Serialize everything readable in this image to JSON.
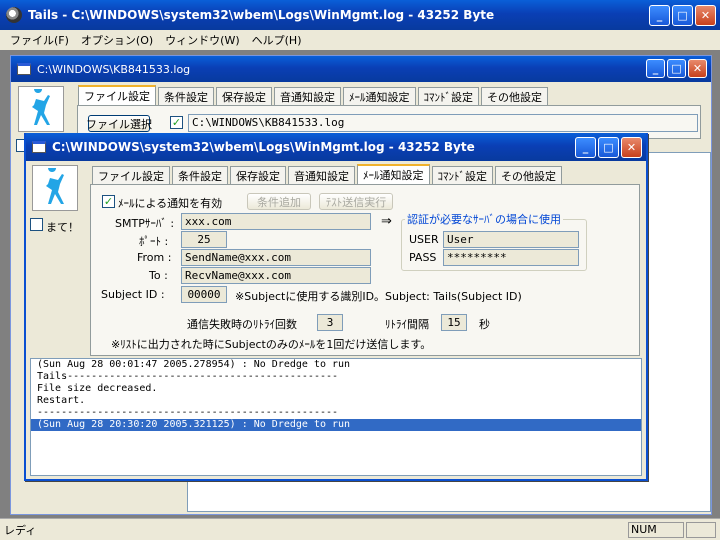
{
  "app": {
    "title": "Tails - C:\\WINDOWS\\system32\\wbem\\Logs\\WinMgmt.log - 43252 Byte",
    "menu": [
      "ファイル(F)",
      "オプション(O)",
      "ウィンドウ(W)",
      "ヘルプ(H)"
    ]
  },
  "window_buttons": {
    "minimize": "_",
    "maximize": "□",
    "close": "✕"
  },
  "status": {
    "main": "レディ",
    "num": "NUM"
  },
  "child1": {
    "title": "C:\\WINDOWS\\KB841533.log",
    "tabs": [
      "ファイル設定",
      "条件設定",
      "保存設定",
      "音通知設定",
      "ﾒｰﾙ通知設定",
      "ｺﾏﾝﾄﾞ設定",
      "その他設定"
    ],
    "file_select_label": "ファイル選択",
    "file_path": "C:\\WINDOWS\\KB841533.log"
  },
  "child2": {
    "title": "C:\\WINDOWS\\system32\\wbem\\Logs\\WinMgmt.log - 43252 Byte",
    "tabs": [
      "ファイル設定",
      "条件設定",
      "保存設定",
      "音通知設定",
      "ﾒｰﾙ通知設定",
      "ｺﾏﾝﾄﾞ設定",
      "その他設定"
    ],
    "active_tab": 4,
    "wait_label": "まて！",
    "mail_enable_label": "ﾒｰﾙによる通知を有効",
    "condition_add_label": "条件追加",
    "test_send_label": "ﾃｽﾄ送信実行",
    "smtp_label": "SMTPｻｰﾊﾞ :",
    "smtp_value": "xxx.com",
    "port_label": "ﾎﾟｰﾄ :",
    "port_value": "25",
    "from_label": "From :",
    "from_value": "SendName@xxx.com",
    "to_label": "To :",
    "to_value": "RecvName@xxx.com",
    "subject_label": "Subject ID :",
    "subject_value": "00000",
    "subject_note": "※Subjectに使用する識別ID。Subject: Tails(Subject ID)",
    "arrow": "⇒",
    "auth_title": "認証が必要なｻｰﾊﾞの場合に使用",
    "user_label": "USER",
    "user_value": "User",
    "pass_label": "PASS",
    "pass_value": "*********",
    "retry_count_label": "通信失敗時のﾘﾄﾗｲ回数",
    "retry_count_value": "3",
    "retry_interval_label": "ﾘﾄﾗｲ間隔",
    "retry_interval_value": "15",
    "retry_interval_unit": "秒",
    "footnote": "※ﾘｽﾄに出力された時にSubjectのみのﾒｰﾙを1回だけ送信します。",
    "log_lines": [
      "(Sun Aug 28 00:01:47 2005.278954) : No Dredge to run",
      "Tails---------------------------------------------",
      "File size decreased.",
      "Restart.",
      "--------------------------------------------------",
      "(Sun Aug 28 20:30:20 2005.321125) : No Dredge to run"
    ],
    "selected_line": 5
  },
  "colors": {
    "title_blue": "#0a4fd1",
    "selection": "#316ac5",
    "tab_accent": "#f0b22c"
  }
}
